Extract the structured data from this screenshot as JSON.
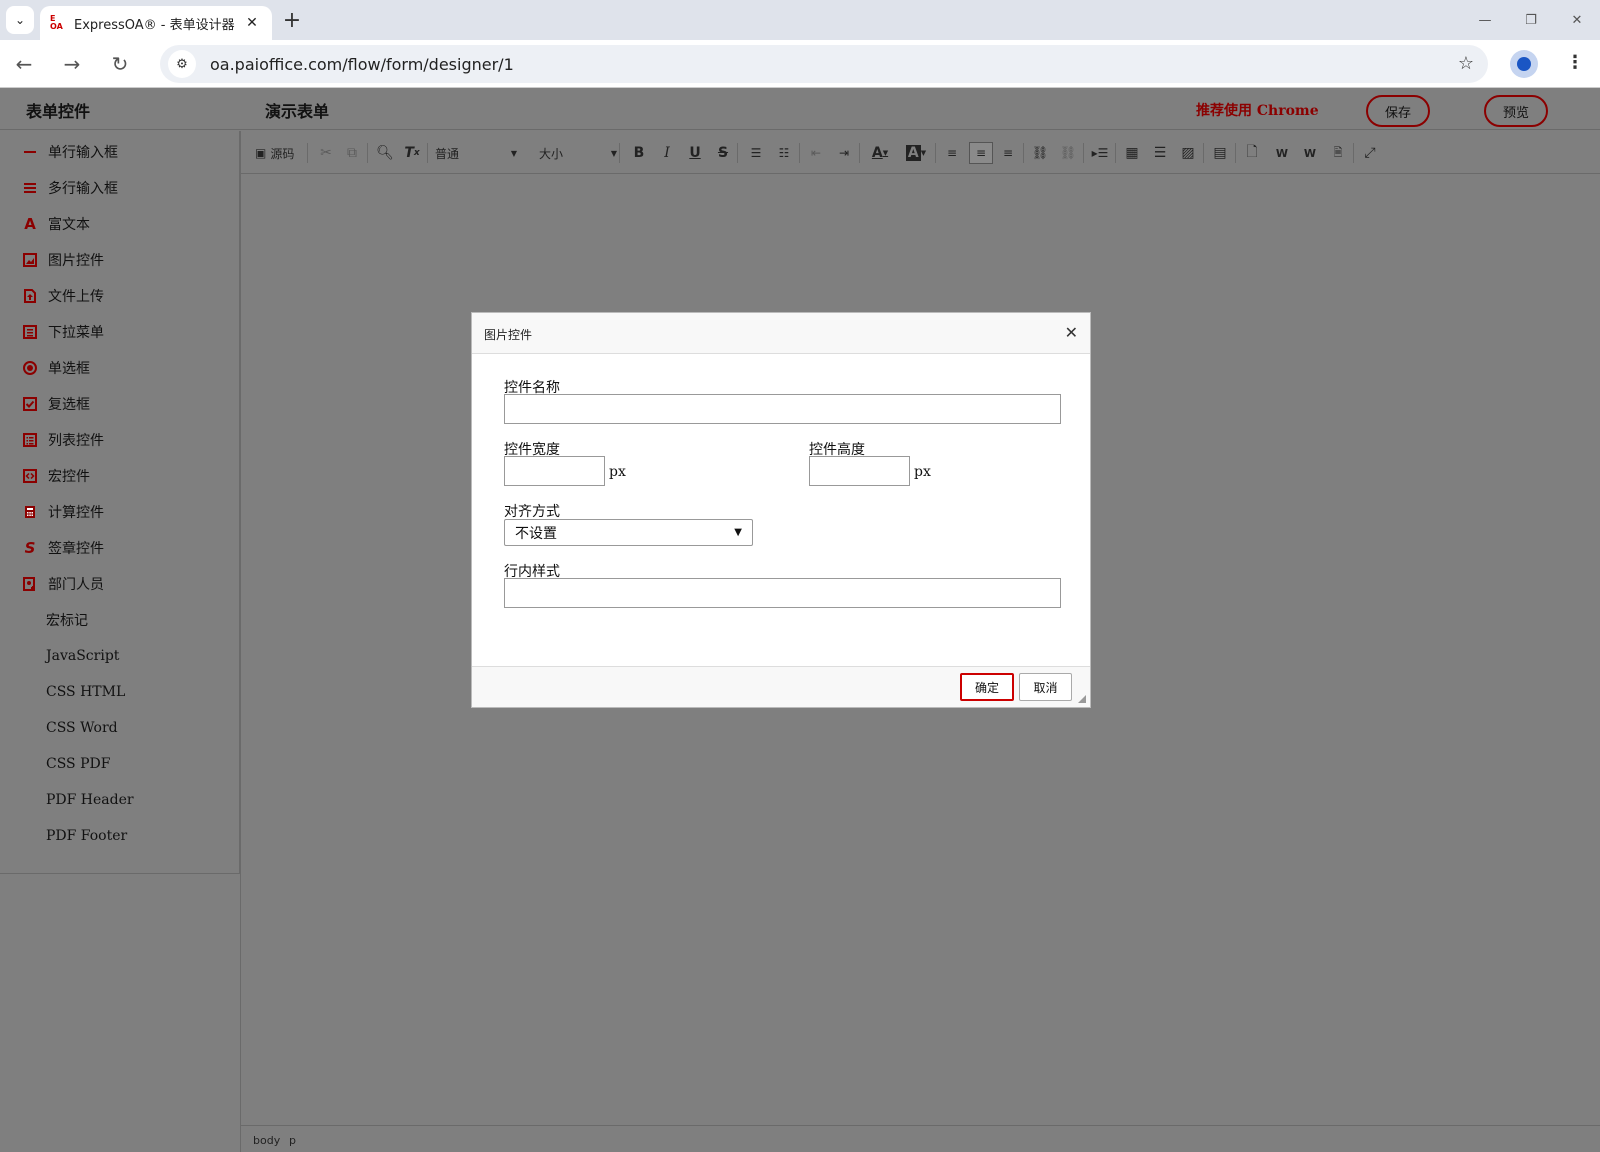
{
  "browser": {
    "tab_title": "ExpressOA® - 表单设计器",
    "favicon_text": "E OA",
    "url": "oa.paioffice.com/flow/form/designer/1"
  },
  "header": {
    "sidebar_title": "表单控件",
    "form_title": "演示表单",
    "recommend": "推荐使用 Chrome",
    "save_label": "保存",
    "preview_label": "预览"
  },
  "sidebar": {
    "items": [
      {
        "label": "单行输入框",
        "icon": "single-line-icon"
      },
      {
        "label": "多行输入框",
        "icon": "multi-line-icon"
      },
      {
        "label": "富文本",
        "icon": "rich-text-icon"
      },
      {
        "label": "图片控件",
        "icon": "image-icon"
      },
      {
        "label": "文件上传",
        "icon": "file-upload-icon"
      },
      {
        "label": "下拉菜单",
        "icon": "dropdown-icon"
      },
      {
        "label": "单选框",
        "icon": "radio-icon"
      },
      {
        "label": "复选框",
        "icon": "checkbox-icon"
      },
      {
        "label": "列表控件",
        "icon": "list-icon"
      },
      {
        "label": "宏控件",
        "icon": "macro-icon"
      },
      {
        "label": "计算控件",
        "icon": "calculator-icon"
      },
      {
        "label": "签章控件",
        "icon": "signature-icon"
      },
      {
        "label": "部门人员",
        "icon": "department-icon"
      },
      {
        "label": "宏标记",
        "icon": ""
      },
      {
        "label": "JavaScript",
        "icon": ""
      },
      {
        "label": "CSS HTML",
        "icon": ""
      },
      {
        "label": "CSS Word",
        "icon": ""
      },
      {
        "label": "CSS PDF",
        "icon": ""
      },
      {
        "label": "PDF Header",
        "icon": ""
      },
      {
        "label": "PDF Footer",
        "icon": ""
      }
    ]
  },
  "editor": {
    "source_label": "源码",
    "format_combo": "普通",
    "size_combo": "大小",
    "status_path": [
      "body",
      "p"
    ]
  },
  "dialog": {
    "title": "图片控件",
    "name_label": "控件名称",
    "name_value": "",
    "width_label": "控件宽度",
    "width_value": "",
    "width_unit": "px",
    "height_label": "控件高度",
    "height_value": "",
    "height_unit": "px",
    "align_label": "对齐方式",
    "align_value": "不设置",
    "style_label": "行内样式",
    "style_value": "",
    "ok_label": "确定",
    "cancel_label": "取消"
  },
  "colors": {
    "accent": "#8b0000",
    "workspace": "#7f7f7f"
  }
}
